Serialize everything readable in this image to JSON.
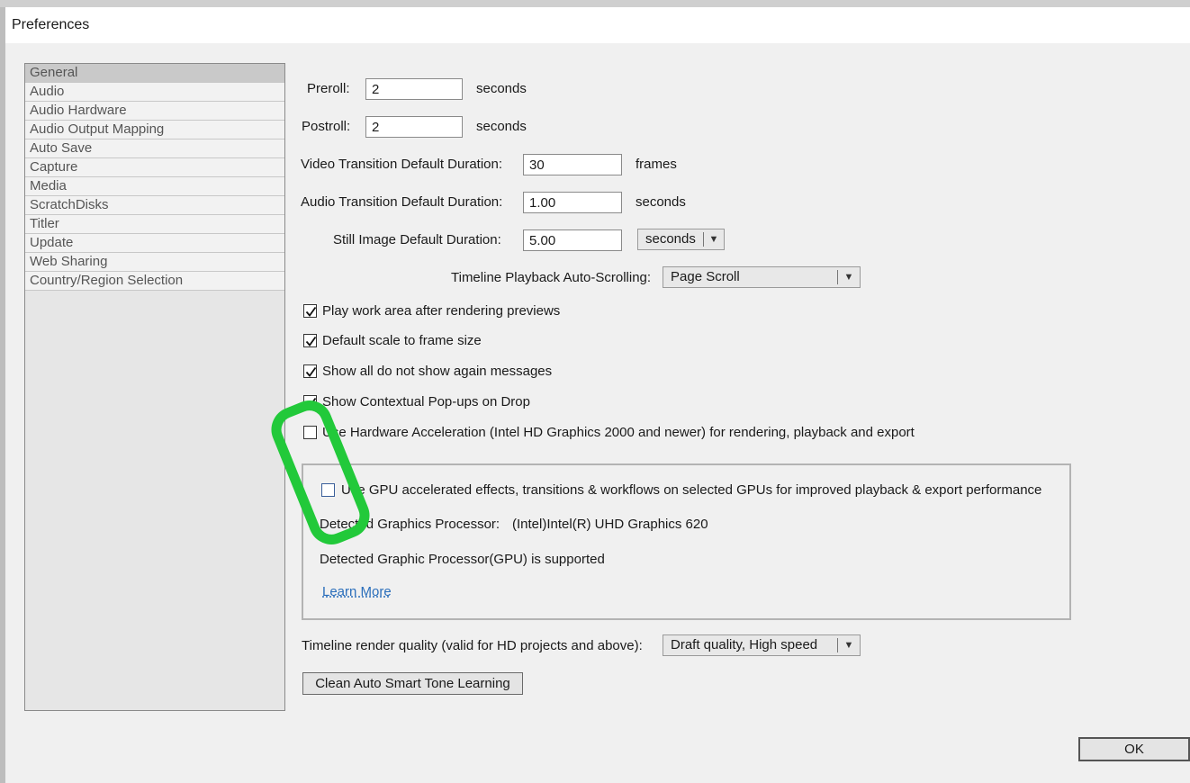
{
  "window": {
    "title": "Preferences"
  },
  "sidebar": {
    "items": [
      {
        "label": "General",
        "selected": true
      },
      {
        "label": "Audio"
      },
      {
        "label": "Audio Hardware"
      },
      {
        "label": "Audio Output Mapping"
      },
      {
        "label": "Auto Save"
      },
      {
        "label": "Capture"
      },
      {
        "label": "Media"
      },
      {
        "label": "ScratchDisks"
      },
      {
        "label": "Titler"
      },
      {
        "label": "Update"
      },
      {
        "label": "Web Sharing"
      },
      {
        "label": "Country/Region Selection"
      }
    ]
  },
  "general": {
    "preroll": {
      "label": "Preroll:",
      "value": "2",
      "unit": "seconds"
    },
    "postroll": {
      "label": "Postroll:",
      "value": "2",
      "unit": "seconds"
    },
    "video_transition": {
      "label": "Video Transition Default Duration:",
      "value": "30",
      "unit": "frames"
    },
    "audio_transition": {
      "label": "Audio Transition Default Duration:",
      "value": "1.00",
      "unit": "seconds"
    },
    "still_image": {
      "label": "Still Image Default Duration:",
      "value": "5.00",
      "unit_select": "seconds"
    },
    "autoscroll": {
      "label": "Timeline Playback Auto-Scrolling:",
      "value": "Page Scroll"
    },
    "checkboxes": [
      {
        "label": "Play work area after rendering previews",
        "checked": true
      },
      {
        "label": "Default scale to frame size",
        "checked": true
      },
      {
        "label": "Show all do not show again messages",
        "checked": true
      },
      {
        "label": "Show Contextual Pop-ups on Drop",
        "checked": true
      },
      {
        "label": "Use Hardware Acceleration (Intel HD Graphics 2000 and newer) for rendering, playback and export",
        "checked": false
      }
    ],
    "gpu": {
      "checkbox_label": "Use GPU accelerated effects, transitions & workflows on selected GPUs for improved playback & export performance",
      "checked": false,
      "detected_label": "Detected Graphics Processor:",
      "detected_value": "(Intel)Intel(R) UHD Graphics 620",
      "support_text": "Detected Graphic Processor(GPU) is supported",
      "learn_more": "Learn More"
    },
    "render_quality": {
      "label": "Timeline render quality (valid for HD projects and above):",
      "value": "Draft quality, High speed"
    },
    "clean_button": "Clean Auto Smart Tone Learning"
  },
  "footer": {
    "ok_label": "OK"
  },
  "colors": {
    "annotation": "#22c93a",
    "link": "#2a6ebb"
  }
}
